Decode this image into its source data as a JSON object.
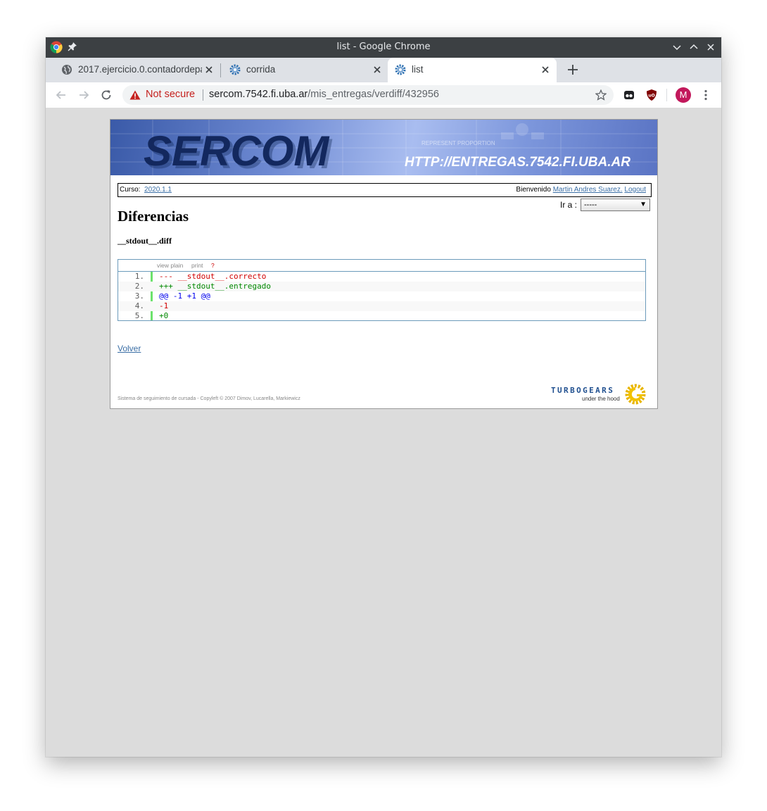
{
  "window": {
    "title": "list - Google Chrome"
  },
  "tabs": [
    {
      "title": "2017.ejercicio.0.contadordepalabras",
      "icon": "globe-icon"
    },
    {
      "title": "corrida",
      "icon": "gear-icon"
    },
    {
      "title": "list",
      "icon": "gear-icon",
      "active": true
    }
  ],
  "address_bar": {
    "security_label": "Not secure",
    "host": "sercom.7542.fi.uba.ar",
    "path": "/mis_entregas/verdiff/432956"
  },
  "profile": {
    "initial": "M",
    "color": "#c2185b"
  },
  "banner": {
    "logo": "SERCOM",
    "url": "HTTP://ENTREGAS.7542.FI.UBA.AR"
  },
  "infobar": {
    "curso_label": "Curso:",
    "curso_value": "2020.1.1",
    "welcome": "Bienvenido",
    "user": "Martin Andres Suarez.",
    "logout": "Logout"
  },
  "goto": {
    "label": "Ir a :",
    "selected": "-----"
  },
  "page": {
    "heading": "Diferencias",
    "filename": "__stdout__.diff"
  },
  "diff_toolbar": {
    "view_plain": "view plain",
    "print": "print",
    "help": "?"
  },
  "diff_lines": [
    {
      "num": "1.",
      "text": "--- __stdout__.correcto",
      "kind": "del"
    },
    {
      "num": "2.",
      "text": "+++ __stdout__.entregado",
      "kind": "add"
    },
    {
      "num": "3.",
      "text": "@@ -1 +1 @@",
      "kind": "hunk"
    },
    {
      "num": "4.",
      "text": "-1",
      "kind": "del"
    },
    {
      "num": "5.",
      "text": "+0",
      "kind": "add"
    }
  ],
  "back_link": "Volver",
  "footer": {
    "copyright": "Sistema de seguimiento de cursada - Copyleft © 2007 Dimov, Lucarella, Markiewicz",
    "logo_word": "TURBOGEARS",
    "logo_sub": "under the hood"
  }
}
